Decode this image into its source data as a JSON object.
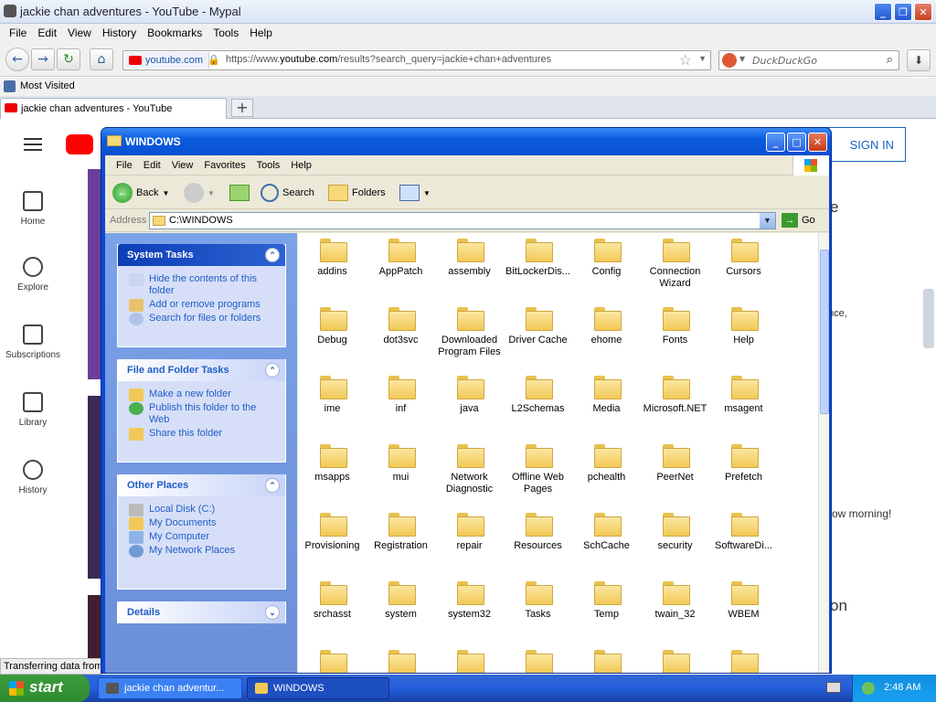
{
  "browser": {
    "window_title": "jackie chan adventures - YouTube - Mypal",
    "menu": [
      "File",
      "Edit",
      "View",
      "History",
      "Bookmarks",
      "Tools",
      "Help"
    ],
    "site_identity": "youtube.com",
    "url_prefix": "https://www.",
    "url_domain": "youtube.com",
    "url_rest": "/results?search_query=jackie+chan+adventures",
    "search_placeholder": "DuckDuckGo",
    "bookmark": "Most Visited",
    "tab_title": "jackie chan adventures - YouTube",
    "status": "Transferring data from"
  },
  "youtube": {
    "nav": [
      "Home",
      "Explore",
      "Subscriptions",
      "Library",
      "History"
    ],
    "sign_in": "SIGN IN",
    "snippet_e": "e",
    "snippet_nce": "nce,",
    "snippet_morning": "row morning!",
    "snippet_on": "on"
  },
  "explorer": {
    "title": "WINDOWS",
    "menu": [
      "File",
      "Edit",
      "View",
      "Favorites",
      "Tools",
      "Help"
    ],
    "toolbar": {
      "back": "Back",
      "search": "Search",
      "folders": "Folders"
    },
    "address_label": "Address",
    "address_value": "C:\\WINDOWS",
    "go": "Go",
    "system_tasks": {
      "title": "System Tasks",
      "items": [
        "Hide the contents of this folder",
        "Add or remove programs",
        "Search for files or folders"
      ]
    },
    "file_tasks": {
      "title": "File and Folder Tasks",
      "items": [
        "Make a new folder",
        "Publish this folder to the Web",
        "Share this folder"
      ]
    },
    "other_places": {
      "title": "Other Places",
      "items": [
        "Local Disk (C:)",
        "My Documents",
        "My Computer",
        "My Network Places"
      ]
    },
    "details": {
      "title": "Details"
    },
    "folders": [
      "addins",
      "AppPatch",
      "assembly",
      "BitLockerDis...",
      "Config",
      "Connection Wizard",
      "Cursors",
      "Debug",
      "dot3svc",
      "Downloaded Program Files",
      "Driver Cache",
      "ehome",
      "Fonts",
      "Help",
      "ime",
      "inf",
      "java",
      "L2Schemas",
      "Media",
      "Microsoft.NET",
      "msagent",
      "msapps",
      "mui",
      "Network Diagnostic",
      "Offline Web Pages",
      "pchealth",
      "PeerNet",
      "Prefetch",
      "Provisioning",
      "Registration",
      "repair",
      "Resources",
      "SchCache",
      "security",
      "SoftwareDi...",
      "srchasst",
      "system",
      "system32",
      "Tasks",
      "Temp",
      "twain_32",
      "WBEM",
      "",
      "",
      "",
      "",
      "",
      "",
      ""
    ]
  },
  "taskbar": {
    "start": "start",
    "items": [
      "jackie chan adventur...",
      "WINDOWS"
    ],
    "clock": "2:48 AM"
  },
  "colors": {
    "xp_blue": "#0a49d6",
    "xp_green": "#3c9a3c",
    "link_blue": "#215dc6",
    "yt_red": "#ff0000"
  }
}
